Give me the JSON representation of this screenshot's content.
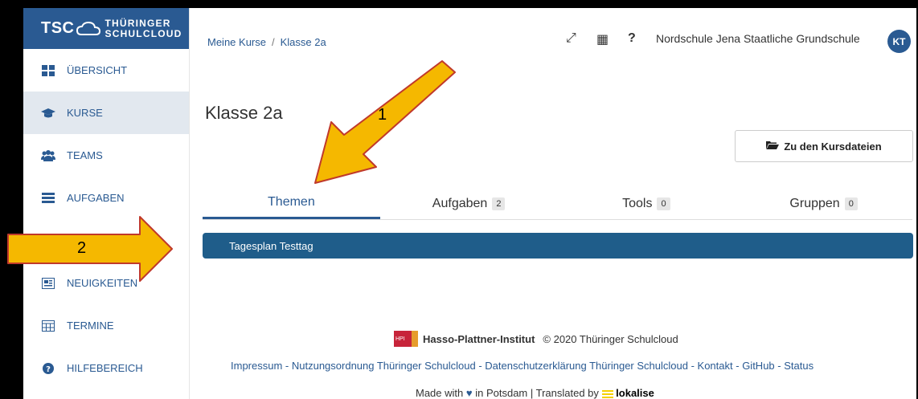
{
  "brand": {
    "short": "TSC",
    "line1": "THÜRINGER",
    "line2": "SCHULCLOUD"
  },
  "sidebar": {
    "items": [
      {
        "label": "ÜBERSICHT",
        "icon": "dashboard-icon"
      },
      {
        "label": "KURSE",
        "icon": "graduation-cap-icon",
        "active": true
      },
      {
        "label": "TEAMS",
        "icon": "users-icon"
      },
      {
        "label": "AUFGABEN",
        "icon": "tasks-icon"
      },
      {
        "label": "NEUIGKEITEN",
        "icon": "newspaper-icon"
      },
      {
        "label": "TERMINE",
        "icon": "calendar-icon"
      },
      {
        "label": "HILFEBEREICH",
        "icon": "question-circle-icon"
      }
    ]
  },
  "header": {
    "breadcrumb": [
      "Meine Kurse",
      "Klasse 2a"
    ],
    "breadcrumb_sep": "/",
    "fullscreen_glyph": "⤢",
    "qr_glyph": "▦",
    "help_glyph": "?",
    "school": "Nordschule Jena Staatliche Grundschule",
    "avatar_initials": "KT"
  },
  "course": {
    "title": "Klasse 2a",
    "files_button": "Zu den Kursdateien",
    "tabs": [
      {
        "label": "Themen",
        "count": "",
        "active": true
      },
      {
        "label": "Aufgaben",
        "count": "2"
      },
      {
        "label": "Tools",
        "count": "0"
      },
      {
        "label": "Gruppen",
        "count": "0"
      }
    ],
    "topics": [
      "Tagesplan Testtag"
    ]
  },
  "footer": {
    "hpi_badge": "HPI",
    "institute": "Hasso-Plattner-Institut",
    "copyright": "© 2020 Thüringer Schulcloud",
    "links": [
      "Impressum",
      "Nutzungsordnung Thüringer Schulcloud",
      "Datenschutzerklärung Thüringer Schulcloud",
      "Kontakt",
      "GitHub",
      "Status"
    ],
    "link_sep": " - ",
    "made_with_pre": "Made with",
    "made_with_mid": "in Potsdam | Translated by",
    "lokalise": "lokalise"
  },
  "annotations": {
    "arrow1": "1",
    "arrow2": "2"
  },
  "colors": {
    "brand": "#2a5a92",
    "topic_bar": "#1f5d8a",
    "arrow_fill": "#f5b800",
    "arrow_stroke": "#c0392b"
  }
}
